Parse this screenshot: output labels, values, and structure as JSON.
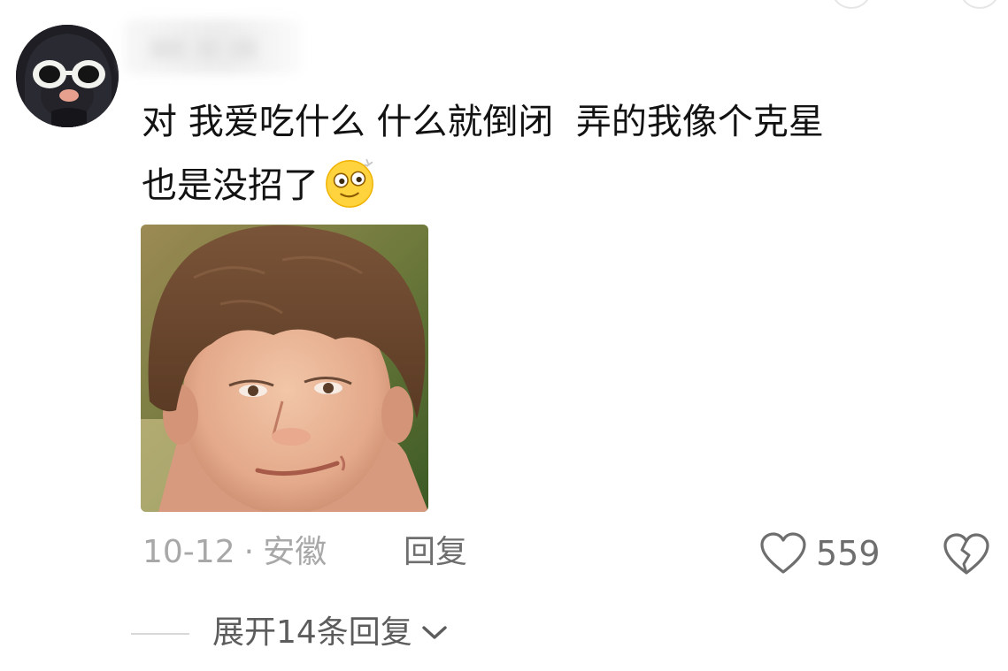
{
  "comment": {
    "line1": "对 我爱吃什么 什么就倒闭  弄的我像个克星",
    "line2": "也是没招了",
    "emoji_icon": "dizzy-face-emoji"
  },
  "meta": {
    "date": "10-12",
    "separator": "·",
    "location": "安徽",
    "reply_label": "回复"
  },
  "actions": {
    "like_count": "559",
    "like_icon": "heart-outline-icon",
    "dislike_icon": "broken-heart-icon"
  },
  "replies": {
    "expand_label": "展开14条回复",
    "expand_icon": "chevron-down-icon"
  },
  "colors": {
    "text_primary": "#121212",
    "text_meta": "#a8a8a8",
    "text_action": "#6e6e6e"
  }
}
